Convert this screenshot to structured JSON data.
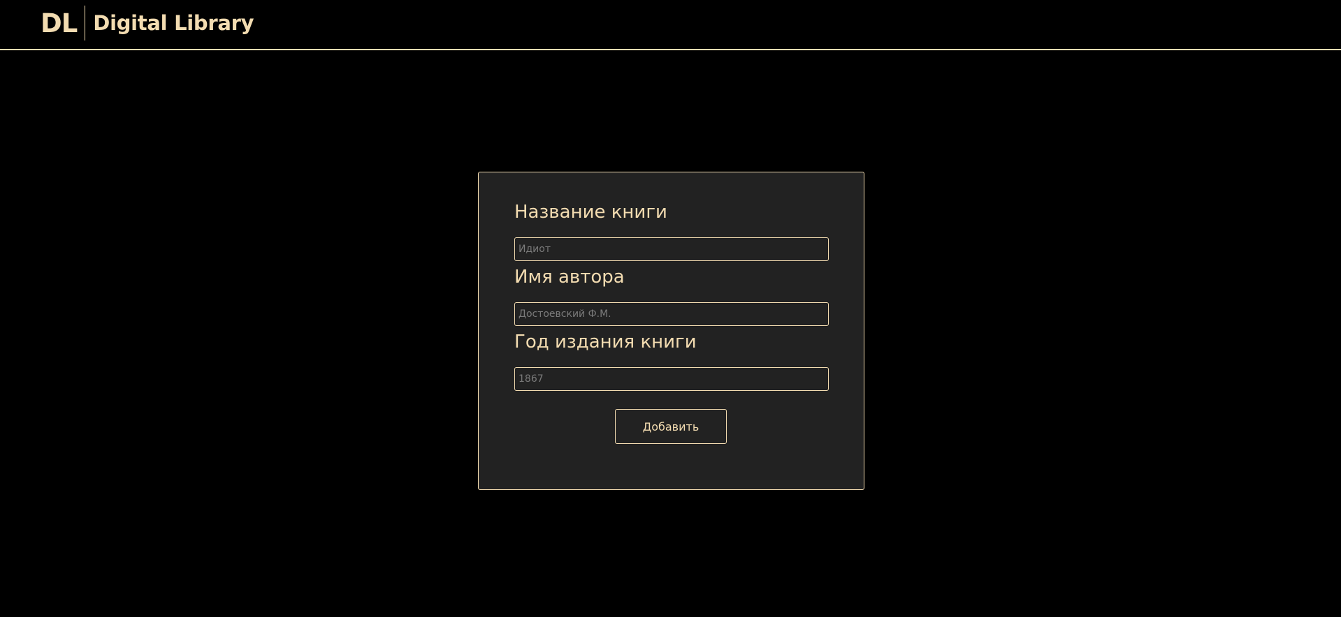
{
  "header": {
    "logo_mark": "DL",
    "site_title": "Digital Library"
  },
  "form": {
    "fields": [
      {
        "label": "Название книги",
        "placeholder": "Идиот",
        "value": ""
      },
      {
        "label": "Имя автора",
        "placeholder": "Достоевский Ф.М.",
        "value": ""
      },
      {
        "label": "Год издания книги",
        "placeholder": "1867",
        "value": ""
      }
    ],
    "submit_label": "Добавить"
  },
  "colors": {
    "accent": "#f3dcb1",
    "background": "#000000",
    "card_background": "#222222",
    "placeholder": "#7a7a7a"
  }
}
